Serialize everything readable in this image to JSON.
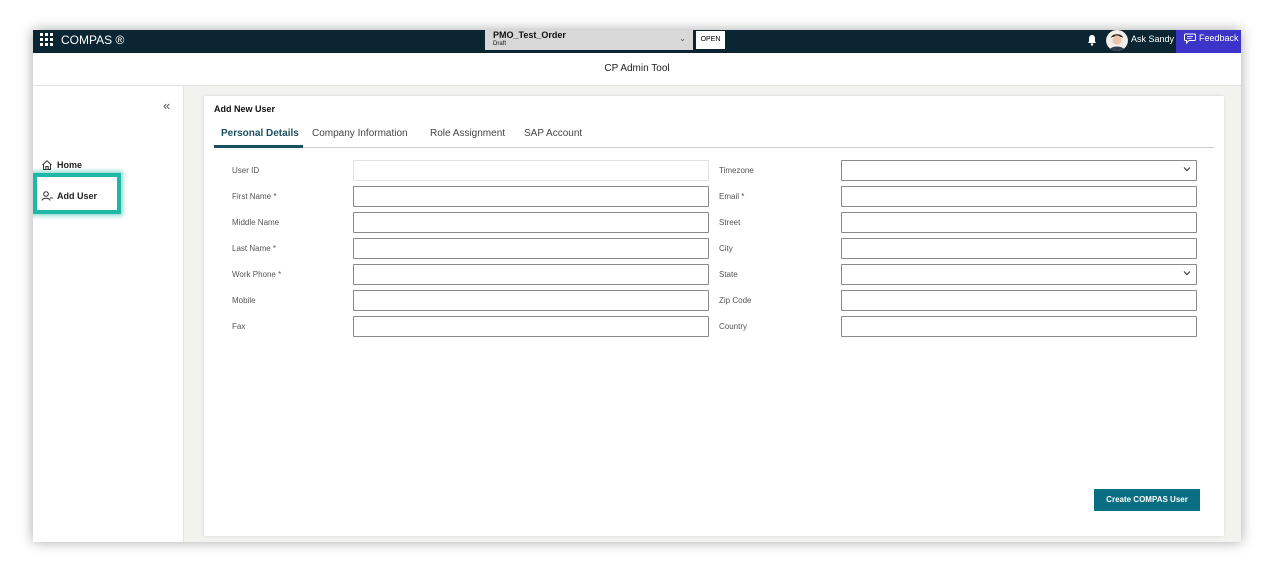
{
  "topbar": {
    "app_title": "COMPAS ®",
    "order": {
      "name": "PMO_Test_Order",
      "status": "Draft"
    },
    "open_label": "OPEN",
    "ask_label": "Ask Sandy",
    "feedback_label": "Feedback"
  },
  "subheader": {
    "title": "CP Admin Tool"
  },
  "sidebar": {
    "items": [
      {
        "label": "Home",
        "icon": "home-icon"
      },
      {
        "label": "Add User",
        "icon": "user-icon"
      }
    ],
    "highlight_color": "#1fb7a6"
  },
  "form": {
    "card_title": "Add New User",
    "tabs": [
      {
        "label": "Personal Details",
        "active": true
      },
      {
        "label": "Company Information"
      },
      {
        "label": "Role Assignment"
      },
      {
        "label": "SAP Account"
      }
    ],
    "left_fields": [
      {
        "label": "User ID",
        "value": ""
      },
      {
        "label": "First Name *",
        "value": ""
      },
      {
        "label": "Middle Name",
        "value": ""
      },
      {
        "label": "Last Name *",
        "value": ""
      },
      {
        "label": "Work Phone *",
        "value": ""
      },
      {
        "label": "Mobile",
        "value": ""
      },
      {
        "label": "Fax",
        "value": ""
      }
    ],
    "right_fields": [
      {
        "label": "Timezone",
        "value": ""
      },
      {
        "label": "Email *",
        "value": ""
      },
      {
        "label": "Street",
        "value": ""
      },
      {
        "label": "City",
        "value": ""
      },
      {
        "label": "State",
        "value": ""
      },
      {
        "label": "Zip Code",
        "value": ""
      },
      {
        "label": "Country",
        "value": ""
      }
    ],
    "submit_label": "Create COMPAS User"
  },
  "colors": {
    "topbar": "#0b2533",
    "feedback": "#3c33c9",
    "accent": "#1d4f63",
    "button": "#0b6e82"
  }
}
